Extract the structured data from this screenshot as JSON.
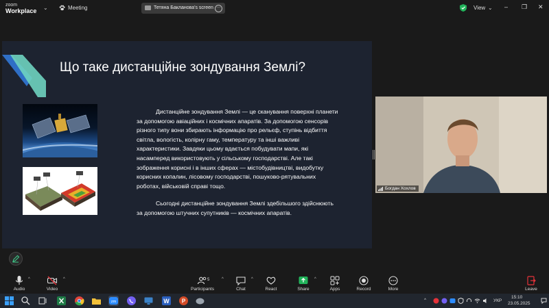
{
  "app": {
    "logo_line1": "zoom",
    "logo_line2": "Workplace"
  },
  "meeting": {
    "label": "Meeting"
  },
  "share": {
    "title": "Тетяна Бакланова's screen",
    "more": "···"
  },
  "top_right": {
    "view_label": "View"
  },
  "slide": {
    "title": "Що таке дистанційне зондування Землі?",
    "paragraphs": [
      "Дистанційне зондування Землі — це сканування поверхні планети за допомогою авіаційних і космічних апаратів. За допомогою сенсорів різного типу вони збирають інформацію про рельєф, ступінь відбиття світла, вологість, колірну гаму, температуру та інші важливі характеристики. Завдяки цьому вдається побудувати мапи, які насамперед використовують у сільському господарстві. Але такі зображення корисні і в інших сферах — містобудівництві, видобутку корисних копалин, лісовому господарстві, пошуково-рятувальних роботах, військовій справі тощо.",
      "Сьогодні дистанційне зондування Землі здебільшого здійснюють за допомогою штучних супутників — космічних апаратів."
    ]
  },
  "participant": {
    "name": "Богдан Хохлов"
  },
  "toolbar": {
    "audio": "Audio",
    "video": "Video",
    "participants": "Participants",
    "participants_count": "5",
    "chat": "Chat",
    "react": "React",
    "share": "Share",
    "apps": "Apps",
    "record": "Record",
    "more": "More",
    "leave": "Leave"
  },
  "taskbar": {
    "language": "УКР",
    "time": "15:10",
    "date": "23.05.2025"
  },
  "colors": {
    "share_green": "#21b35a",
    "leave_red": "#e5333a",
    "slide_bg": "#1d2330",
    "accent_teal": "#6fd3c0",
    "accent_blue": "#2f6fc6"
  }
}
